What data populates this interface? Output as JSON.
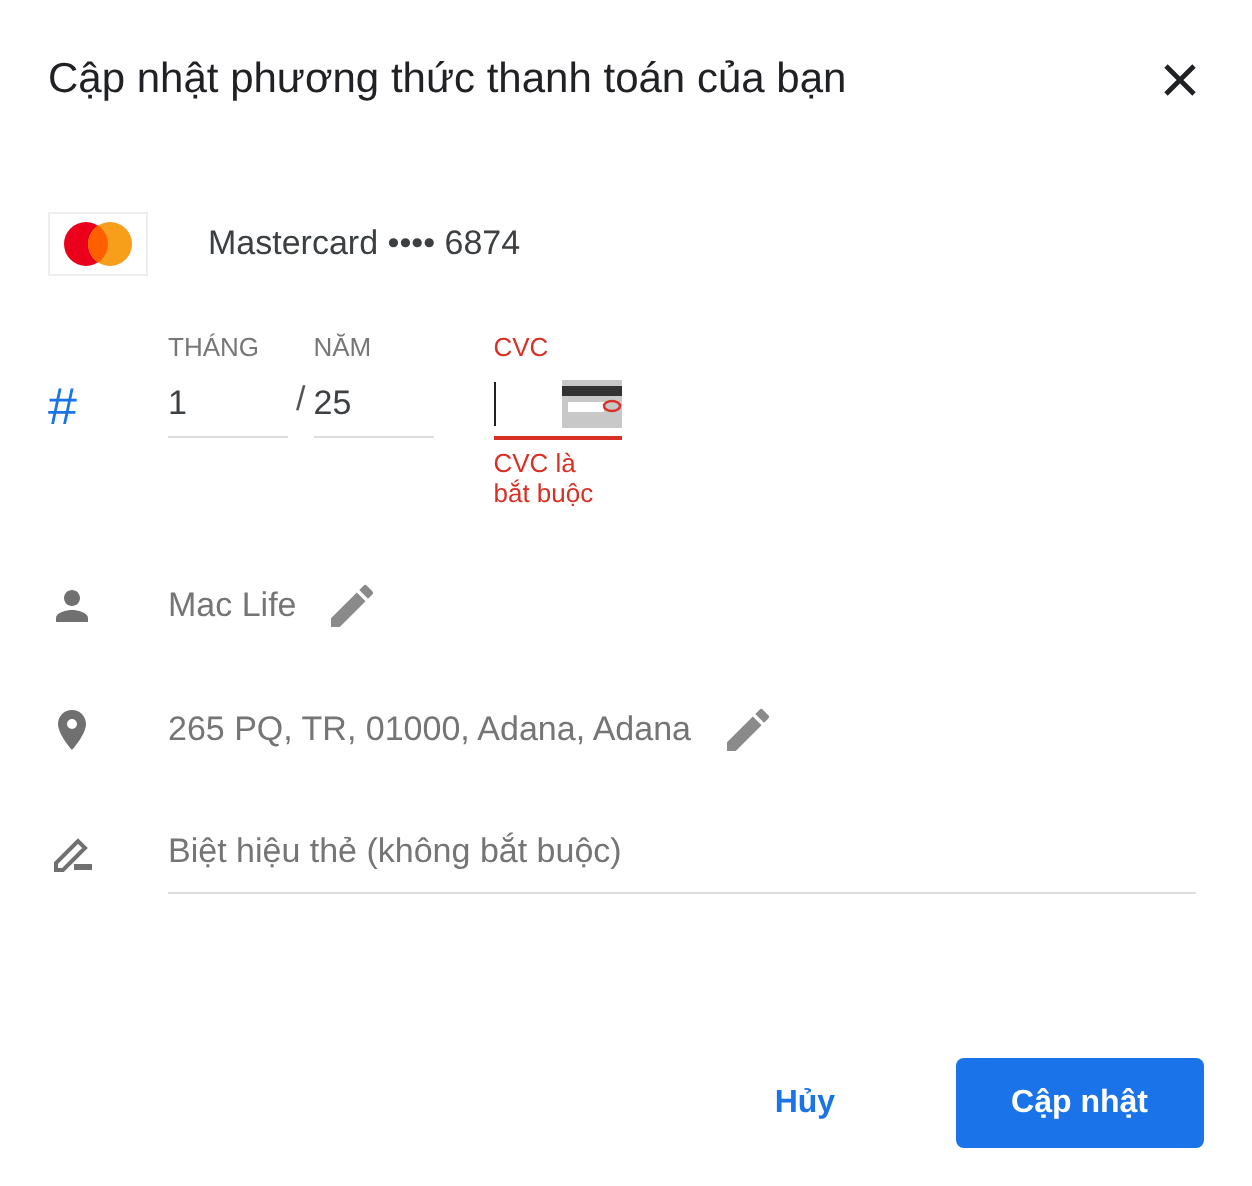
{
  "dialog": {
    "title": "Cập nhật phương thức thanh toán của bạn"
  },
  "card": {
    "name": "Mastercard •••• 6874"
  },
  "expiry": {
    "symbol": "#",
    "month": {
      "label": "THÁNG",
      "value": "1"
    },
    "separator": "/",
    "year": {
      "label": "NĂM",
      "value": "25"
    },
    "cvc": {
      "label": "CVC",
      "error": true,
      "error_text": "CVC là bắt buộc"
    }
  },
  "details": [
    {
      "kind": "name",
      "value": "Mac Life",
      "editable": true
    },
    {
      "kind": "address",
      "value": "265 PQ, TR, 01000, Adana, Adana",
      "editable": true
    }
  ],
  "nickname": {
    "placeholder": "Biệt hiệu thẻ (không bắt buộc)"
  },
  "buttons": [
    {
      "label": "Hủy",
      "kind": "text"
    },
    {
      "label": "Cập nhật",
      "kind": "primary"
    }
  ]
}
